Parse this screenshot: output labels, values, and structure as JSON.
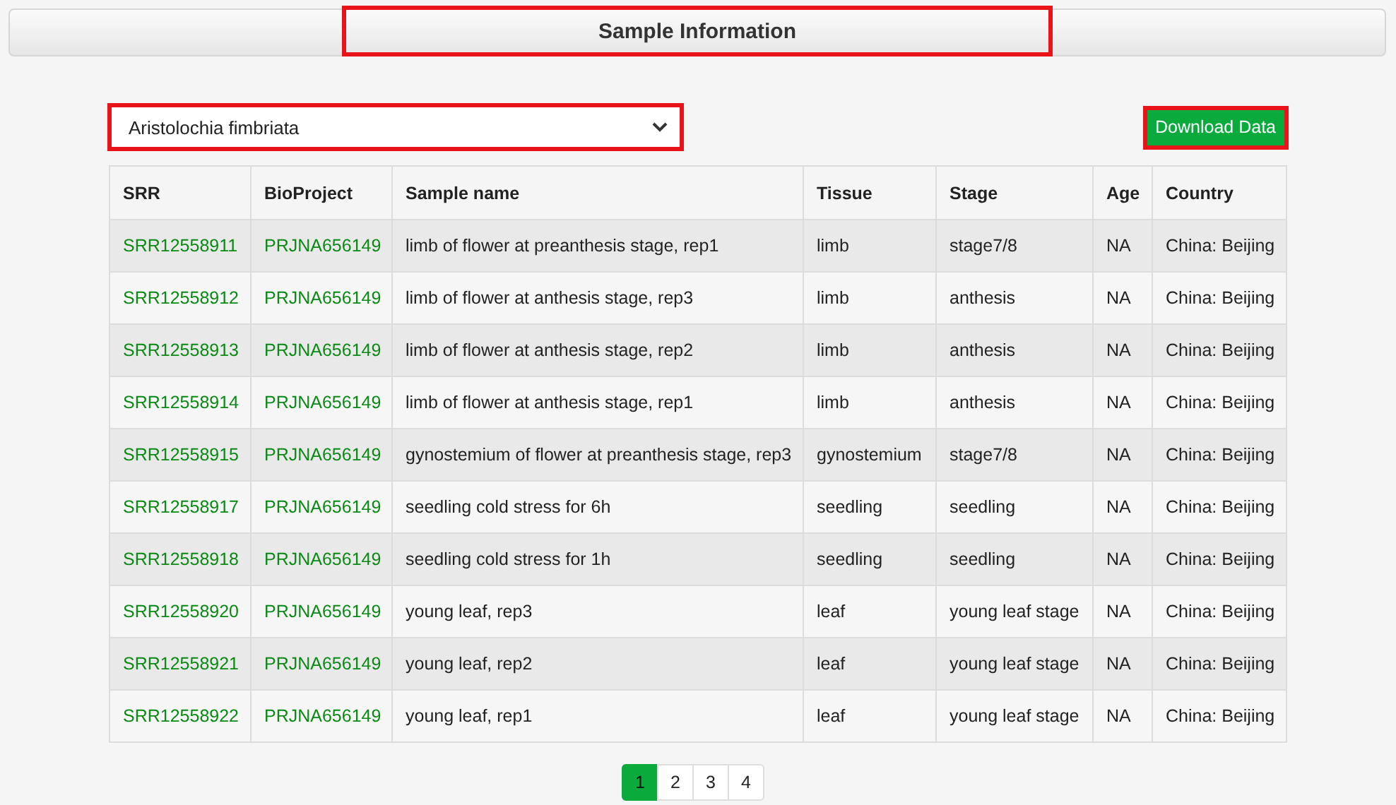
{
  "header": {
    "title": "Sample Information",
    "highlighted": true
  },
  "species_select": {
    "value": "Aristolochia fimbriata",
    "highlighted": true
  },
  "download_button": {
    "label": "Download Data",
    "highlighted": true
  },
  "table": {
    "columns": [
      "SRR",
      "BioProject",
      "Sample name",
      "Tissue",
      "Stage",
      "Age",
      "Country"
    ],
    "rows": [
      [
        "SRR12558911",
        "PRJNA656149",
        "limb of flower at preanthesis stage, rep1",
        "limb",
        "stage7/8",
        "NA",
        "China: Beijing"
      ],
      [
        "SRR12558912",
        "PRJNA656149",
        "limb of flower at anthesis stage, rep3",
        "limb",
        "anthesis",
        "NA",
        "China: Beijing"
      ],
      [
        "SRR12558913",
        "PRJNA656149",
        "limb of flower at anthesis stage, rep2",
        "limb",
        "anthesis",
        "NA",
        "China: Beijing"
      ],
      [
        "SRR12558914",
        "PRJNA656149",
        "limb of flower at anthesis stage, rep1",
        "limb",
        "anthesis",
        "NA",
        "China: Beijing"
      ],
      [
        "SRR12558915",
        "PRJNA656149",
        "gynostemium of flower at preanthesis stage, rep3",
        "gynostemium",
        "stage7/8",
        "NA",
        "China: Beijing"
      ],
      [
        "SRR12558917",
        "PRJNA656149",
        "seedling cold stress for 6h",
        "seedling",
        "seedling",
        "NA",
        "China: Beijing"
      ],
      [
        "SRR12558918",
        "PRJNA656149",
        "seedling cold stress for 1h",
        "seedling",
        "seedling",
        "NA",
        "China: Beijing"
      ],
      [
        "SRR12558920",
        "PRJNA656149",
        "young leaf, rep3",
        "leaf",
        "young leaf stage",
        "NA",
        "China: Beijing"
      ],
      [
        "SRR12558921",
        "PRJNA656149",
        "young leaf, rep2",
        "leaf",
        "young leaf stage",
        "NA",
        "China: Beijing"
      ],
      [
        "SRR12558922",
        "PRJNA656149",
        "young leaf, rep1",
        "leaf",
        "young leaf stage",
        "NA",
        "China: Beijing"
      ]
    ]
  },
  "pagination": [
    {
      "label": "1",
      "selected": true
    },
    {
      "label": "2",
      "selected": false
    },
    {
      "label": "3",
      "selected": false
    },
    {
      "label": "4",
      "selected": false
    }
  ]
}
